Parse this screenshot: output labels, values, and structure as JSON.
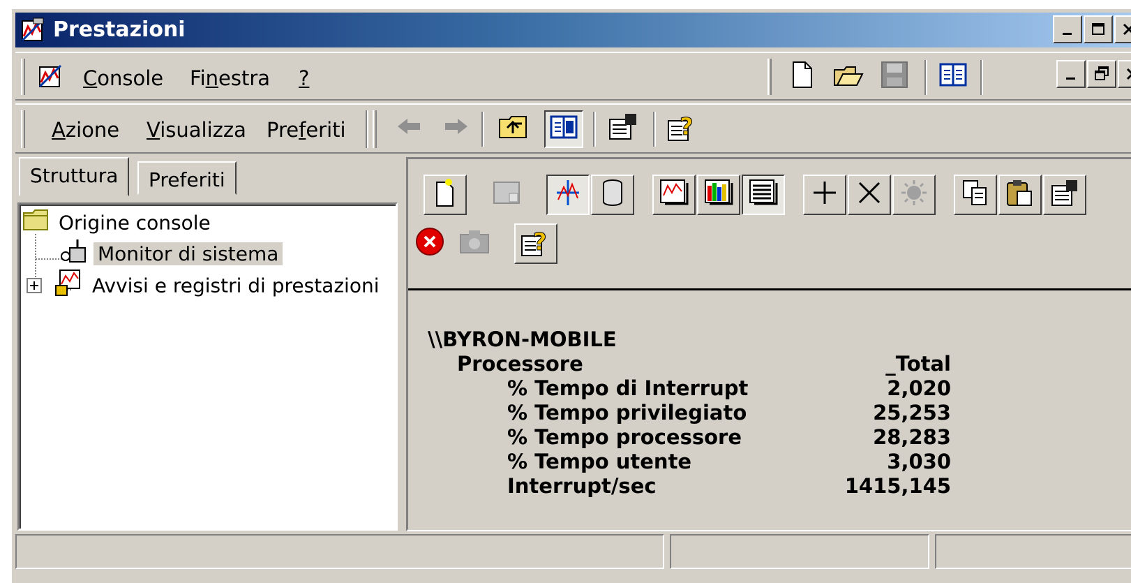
{
  "window": {
    "title": "Prestazioni"
  },
  "menu1": {
    "items": [
      {
        "label": "Console",
        "underline": "C"
      },
      {
        "label": "Finestra",
        "underline": "n"
      },
      {
        "label": "?",
        "underline": "?"
      }
    ]
  },
  "menu2": {
    "items": [
      {
        "label": "Azione",
        "underline": "A"
      },
      {
        "label": "Visualizza",
        "underline": "V"
      },
      {
        "label": "Preferiti",
        "underline": "f"
      }
    ]
  },
  "tabs": {
    "tree": "Struttura",
    "favorites": "Preferiti"
  },
  "tree": {
    "root": "Origine console",
    "items": [
      "Monitor di sistema",
      "Avvisi e registri di prestazioni"
    ]
  },
  "report": {
    "computer": "\\\\BYRON-MOBILE",
    "object": "Processore",
    "instance": "_Total",
    "counters": [
      {
        "name": "% Tempo di Interrupt",
        "value": "2,020"
      },
      {
        "name": "% Tempo privilegiato",
        "value": "25,253"
      },
      {
        "name": "% Tempo processore",
        "value": "28,283"
      },
      {
        "name": "% Tempo utente",
        "value": "3,030"
      },
      {
        "name": "Interrupt/sec",
        "value": "1415,145"
      }
    ]
  },
  "icons": {
    "app": "performance-monitor-icon",
    "new": "new-document-icon",
    "open": "open-folder-icon",
    "save": "save-disk-icon"
  },
  "colors": {
    "titlebar_start": "#0a246a",
    "titlebar_end": "#a6caf0",
    "face": "#d4d0c8"
  }
}
